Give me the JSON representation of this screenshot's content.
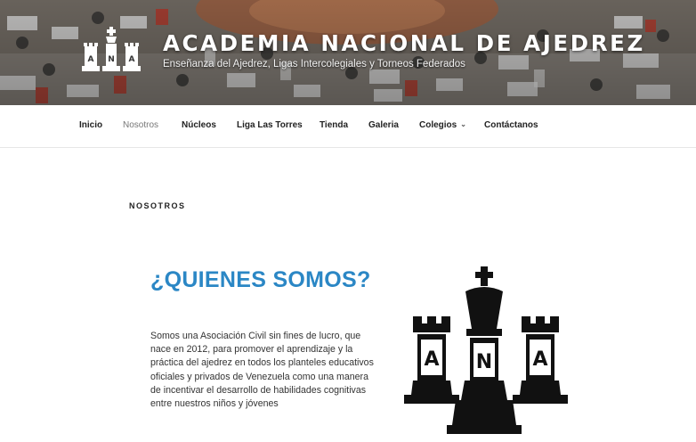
{
  "header": {
    "title": "ACADEMIA NACIONAL DE AJEDREZ",
    "tagline": "Enseñanza del Ajedrez, Ligas Intercolegiales y Torneos Federados",
    "logo_letters": [
      "A",
      "N",
      "A"
    ]
  },
  "nav": {
    "items": [
      {
        "label": "Inicio"
      },
      {
        "label": "Nosotros",
        "active": true
      },
      {
        "label": "Núcleos"
      },
      {
        "label": "Liga Las Torres"
      },
      {
        "label": "Tienda"
      },
      {
        "label": "Galeria"
      },
      {
        "label": "Colegios",
        "has_dropdown": true
      },
      {
        "label": "Contáctanos"
      }
    ]
  },
  "page": {
    "heading": "NOSOTROS",
    "section_title": "¿QUIENES SOMOS?",
    "body": "Somos una  Asociación Civil sin fines de lucro, que nace en 2012,  para promover el aprendizaje y la práctica del ajedrez en todos los planteles educativos oficiales y privados de Venezuela como una manera de incentivar el desarrollo de habilidades cognitivas entre nuestros niños y jóvenes"
  },
  "colors": {
    "accent": "#2b87c5",
    "active_nav": "#777777",
    "text": "#222222"
  },
  "icons": {
    "dropdown": "chevron-down-icon"
  }
}
